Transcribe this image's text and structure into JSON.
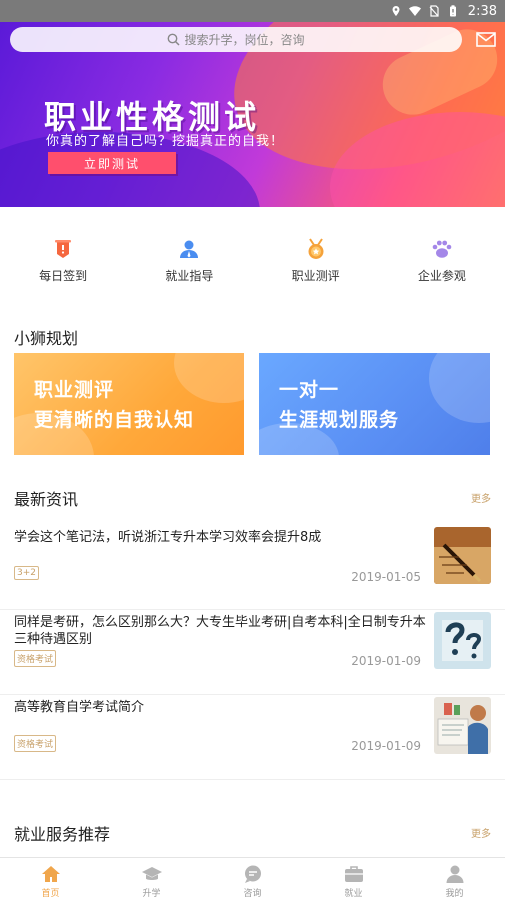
{
  "status_bar": {
    "time": "2:38"
  },
  "search": {
    "placeholder": "搜索升学，岗位，咨询"
  },
  "banner": {
    "title": "职业性格测试",
    "subtitle": "你真的了解自己吗？挖掘真正的自我！",
    "button": "立即测试"
  },
  "quick_nav": [
    {
      "label": "每日签到",
      "icon": "sign-in-icon",
      "color": "#f5673f"
    },
    {
      "label": "就业指导",
      "icon": "user-guide-icon",
      "color": "#4a8df0"
    },
    {
      "label": "职业测评",
      "icon": "medal-icon",
      "color": "#f5a23a"
    },
    {
      "label": "企业参观",
      "icon": "paw-icon",
      "color": "#a487e8"
    }
  ],
  "planning": {
    "title": "小狮规划",
    "cards": [
      {
        "line1": "职业测评",
        "line2": "更清晰的自我认知"
      },
      {
        "line1": "一对一",
        "line2": "生涯规划服务"
      }
    ]
  },
  "news": {
    "title": "最新资讯",
    "more": "更多",
    "items": [
      {
        "title": "学会这个笔记法，听说浙江专升本学习效率会提升8成",
        "tag": "3+2",
        "date": "2019-01-05",
        "thumb": "pen-writing-thumbnail"
      },
      {
        "title": "同样是考研，怎么区别那么大？大专生毕业考研|自考本科|全日制专升本三种待遇区别",
        "tag": "资格考试",
        "date": "2019-01-09",
        "thumb": "question-marks-thumbnail"
      },
      {
        "title": "高等教育自学考试简介",
        "tag": "资格考试",
        "date": "2019-01-09",
        "thumb": "student-desk-thumbnail"
      }
    ]
  },
  "services": {
    "title": "就业服务推荐",
    "more": "更多"
  },
  "tabbar": [
    {
      "label": "首页",
      "icon": "home-icon",
      "active": true
    },
    {
      "label": "升学",
      "icon": "graduation-cap-icon",
      "active": false
    },
    {
      "label": "咨询",
      "icon": "chat-icon",
      "active": false
    },
    {
      "label": "就业",
      "icon": "briefcase-icon",
      "active": false
    },
    {
      "label": "我的",
      "icon": "profile-icon",
      "active": false
    }
  ],
  "colors": {
    "accent": "#f0a64c",
    "tag": "#c8a16a"
  }
}
